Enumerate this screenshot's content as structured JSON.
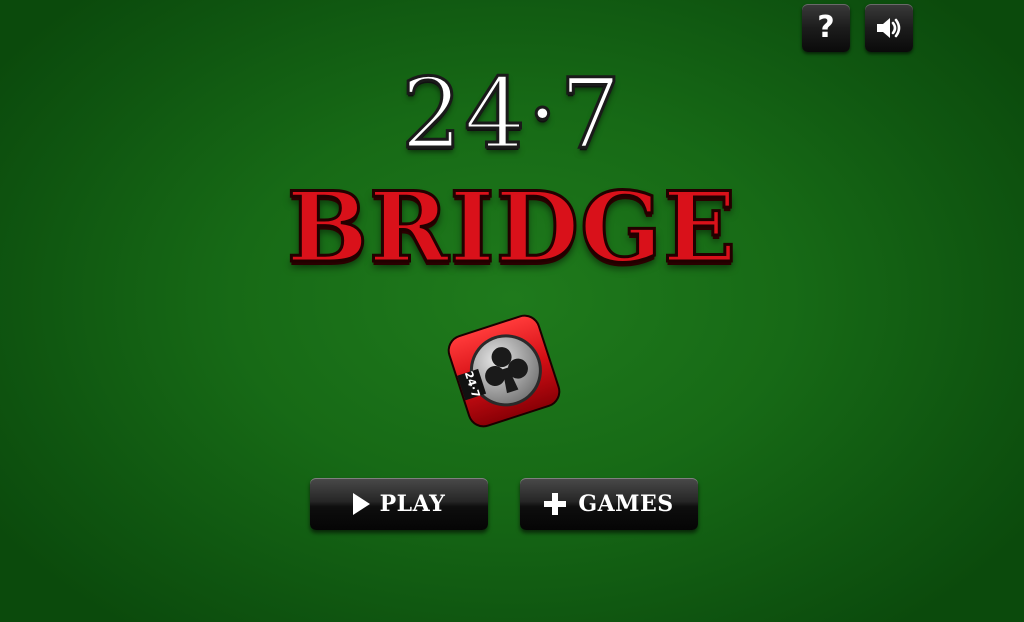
{
  "toolbar": {
    "help_label": "?",
    "help_icon": "question-icon",
    "sound_icon": "speaker-icon"
  },
  "title": {
    "number": "24·7",
    "word": "BRIDGE"
  },
  "logo": {
    "badge_text": "24·7",
    "suit_icon": "club-icon"
  },
  "menu": {
    "play_label": "PLAY",
    "play_icon": "play-icon",
    "games_label": "GAMES",
    "games_icon": "plus-icon"
  },
  "colors": {
    "felt": "#176a16",
    "title_red": "#d9111a",
    "button_dark": "#1c1c1c"
  }
}
